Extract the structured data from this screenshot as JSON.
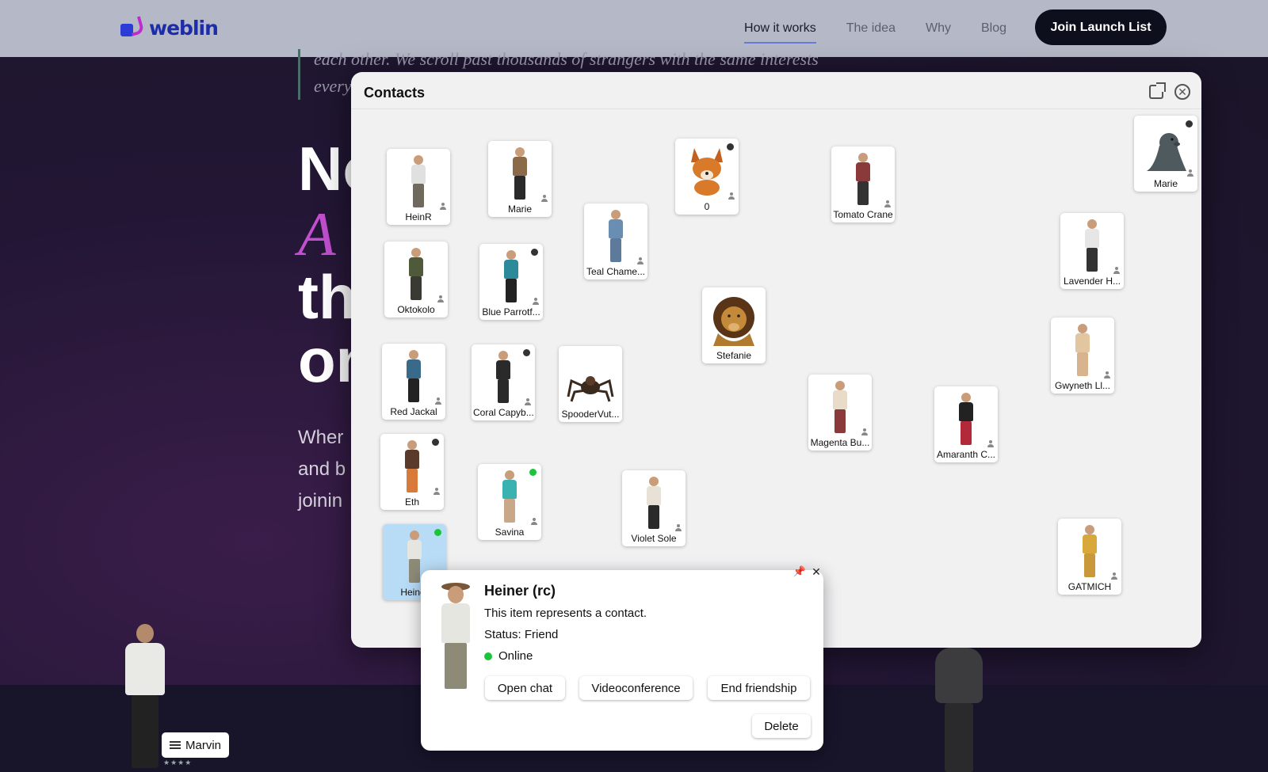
{
  "nav": {
    "brand": "weblin",
    "links": [
      "How it works",
      "The idea",
      "Why",
      "Blog"
    ],
    "cta": "Join Launch List"
  },
  "hero": {
    "quote_line1": "each other. We scroll past thousands of strangers with the same interests",
    "quote_line2": "every",
    "heading1": "No",
    "heading2": "A l",
    "heading3": "th",
    "heading4": "on",
    "para1": "Wher",
    "para2": "and b",
    "para3": "joinin"
  },
  "contacts": {
    "title": "Contacts",
    "cards": [
      {
        "name": "HeinR",
        "status": "",
        "torso": "#e0e0e0",
        "legs": "#6f6a5e"
      },
      {
        "name": "Marie",
        "status": "",
        "torso": "#8a6a48",
        "legs": "#2a2a2a"
      },
      {
        "name": "Oktokolo",
        "status": "",
        "torso": "#4e5a3a",
        "legs": "#3a3a32"
      },
      {
        "name": "Blue Parrotf...",
        "status": "offline",
        "torso": "#2c8a9a",
        "legs": "#222"
      },
      {
        "name": "Teal Chame...",
        "status": "",
        "torso": "#6a8eb2",
        "legs": "#5e7a9a"
      },
      {
        "name": "0",
        "status": "offline",
        "torso": "#d87a2a",
        "legs": "#d87a2a"
      },
      {
        "name": "Tomato Crane",
        "status": "",
        "torso": "#8a3a3a",
        "legs": "#333"
      },
      {
        "name": "Marie",
        "status": "offline",
        "torso": "#4e5a5e",
        "legs": "#4e5a5e"
      },
      {
        "name": "Lavender H...",
        "status": "",
        "torso": "#e6e6e6",
        "legs": "#333"
      },
      {
        "name": "Stefanie",
        "status": "",
        "torso": "#b87a2a",
        "legs": "#7a4a1a"
      },
      {
        "name": "Red Jackal",
        "status": "",
        "torso": "#3a6a8a",
        "legs": "#222"
      },
      {
        "name": "Coral Capyb...",
        "status": "offline",
        "torso": "#2a2a2a",
        "legs": "#2a2a2a"
      },
      {
        "name": "SpooderVut...",
        "status": "",
        "torso": "#3a2a1e",
        "legs": "#3a2a1e"
      },
      {
        "name": "Gwyneth Ll...",
        "status": "",
        "torso": "#e2c6a0",
        "legs": "#d8b48e"
      },
      {
        "name": "Magenta Bu...",
        "status": "",
        "torso": "#e8dcc8",
        "legs": "#8a3a3a"
      },
      {
        "name": "Amaranth C...",
        "status": "",
        "torso": "#222",
        "legs": "#b22a3a"
      },
      {
        "name": "Eth",
        "status": "offline",
        "torso": "#5a3a2a",
        "legs": "#d87a3a"
      },
      {
        "name": "Savina",
        "status": "online",
        "torso": "#3ab2b2",
        "legs": "#c8a888"
      },
      {
        "name": "Violet Sole",
        "status": "",
        "torso": "#e8e2d6",
        "legs": "#2a2a2a"
      },
      {
        "name": "GATMICH",
        "status": "",
        "torso": "#d8a83a",
        "legs": "#c8983a"
      },
      {
        "name": "Heiner",
        "status": "online",
        "torso": "#e6e6e0",
        "legs": "#8e8a78"
      }
    ]
  },
  "popup": {
    "title": "Heiner (rc)",
    "description": "This item represents a contact.",
    "status": "Status: Friend",
    "online": "Online",
    "open_chat": "Open chat",
    "videoconference": "Videoconference",
    "end_friendship": "End friendship",
    "delete": "Delete"
  },
  "user": {
    "name": "Marvin",
    "stars": "★★★★"
  }
}
